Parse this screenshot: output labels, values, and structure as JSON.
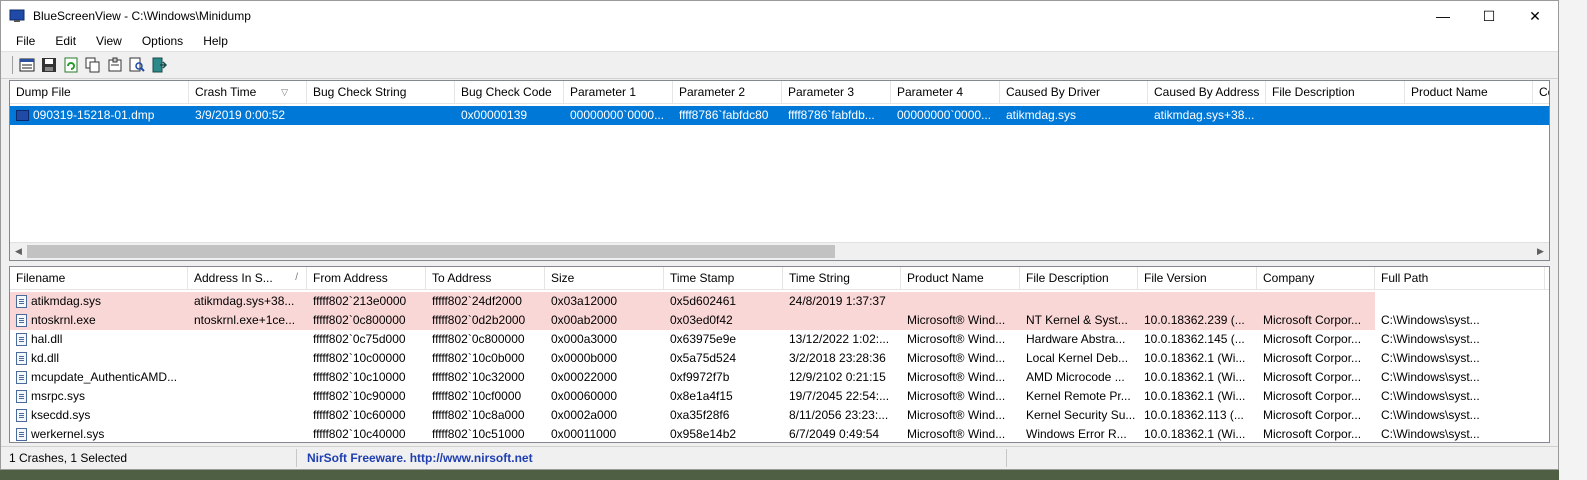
{
  "window": {
    "app_name": "BlueScreenView",
    "title": "BlueScreenView  -  C:\\Windows\\Minidump",
    "minimize_glyph": "—",
    "maximize_glyph": "☐",
    "close_glyph": "✕"
  },
  "menu": [
    "File",
    "Edit",
    "View",
    "Options",
    "Help"
  ],
  "toolbar_icons": [
    "properties-icon",
    "save-icon",
    "refresh-icon",
    "copy-icon",
    "advanced-options-icon",
    "find-icon",
    "exit-icon"
  ],
  "crash_list": {
    "columns": [
      "Dump File",
      "Crash Time",
      "Bug Check String",
      "Bug Check Code",
      "Parameter 1",
      "Parameter 2",
      "Parameter 3",
      "Parameter 4",
      "Caused By Driver",
      "Caused By Address",
      "File Description",
      "Product Name",
      "Com"
    ],
    "sort_indicator": "▽",
    "rows": [
      [
        "090319-15218-01.dmp",
        "3/9/2019 0:00:52",
        "",
        "0x00000139",
        "00000000`0000...",
        "ffff8786`fabfdc80",
        "ffff8786`fabfdb...",
        "00000000`0000...",
        "atikmdag.sys",
        "atikmdag.sys+38...",
        "",
        "",
        ""
      ]
    ]
  },
  "module_list": {
    "columns": [
      "Filename",
      "Address In S...",
      "From Address",
      "To Address",
      "Size",
      "Time Stamp",
      "Time String",
      "Product Name",
      "File Description",
      "File Version",
      "Company",
      "Full Path"
    ],
    "sort_indicator": "/",
    "rows": [
      {
        "highlight": true,
        "cells": [
          "atikmdag.sys",
          "atikmdag.sys+38...",
          "fffff802`213e0000",
          "fffff802`24df2000",
          "0x03a12000",
          "0x5d602461",
          "24/8/2019 1:37:37",
          "",
          "",
          "",
          "",
          ""
        ]
      },
      {
        "highlight": true,
        "cells": [
          "ntoskrnl.exe",
          "ntoskrnl.exe+1ce...",
          "fffff802`0c800000",
          "fffff802`0d2b2000",
          "0x00ab2000",
          "0x03ed0f42",
          "",
          "Microsoft® Wind...",
          "NT Kernel & Syst...",
          "10.0.18362.239 (...",
          "Microsoft Corpor...",
          "C:\\Windows\\syst..."
        ]
      },
      {
        "highlight": false,
        "cells": [
          "hal.dll",
          "",
          "fffff802`0c75d000",
          "fffff802`0c800000",
          "0x000a3000",
          "0x63975e9e",
          "13/12/2022 1:02:...",
          "Microsoft® Wind...",
          "Hardware Abstra...",
          "10.0.18362.145 (...",
          "Microsoft Corpor...",
          "C:\\Windows\\syst..."
        ]
      },
      {
        "highlight": false,
        "cells": [
          "kd.dll",
          "",
          "fffff802`10c00000",
          "fffff802`10c0b000",
          "0x0000b000",
          "0x5a75d524",
          "3/2/2018 23:28:36",
          "Microsoft® Wind...",
          "Local Kernel Deb...",
          "10.0.18362.1 (Wi...",
          "Microsoft Corpor...",
          "C:\\Windows\\syst..."
        ]
      },
      {
        "highlight": false,
        "cells": [
          "mcupdate_AuthenticAMD...",
          "",
          "fffff802`10c10000",
          "fffff802`10c32000",
          "0x00022000",
          "0xf9972f7b",
          "12/9/2102 0:21:15",
          "Microsoft® Wind...",
          "AMD Microcode ...",
          "10.0.18362.1 (Wi...",
          "Microsoft Corpor...",
          "C:\\Windows\\syst..."
        ]
      },
      {
        "highlight": false,
        "cells": [
          "msrpc.sys",
          "",
          "fffff802`10c90000",
          "fffff802`10cf0000",
          "0x00060000",
          "0x8e1a4f15",
          "19/7/2045 22:54:...",
          "Microsoft® Wind...",
          "Kernel Remote Pr...",
          "10.0.18362.1 (Wi...",
          "Microsoft Corpor...",
          "C:\\Windows\\syst..."
        ]
      },
      {
        "highlight": false,
        "cells": [
          "ksecdd.sys",
          "",
          "fffff802`10c60000",
          "fffff802`10c8a000",
          "0x0002a000",
          "0xa35f28f6",
          "8/11/2056 23:23:...",
          "Microsoft® Wind...",
          "Kernel Security Su...",
          "10.0.18362.113 (...",
          "Microsoft Corpor...",
          "C:\\Windows\\syst..."
        ]
      },
      {
        "highlight": false,
        "cells": [
          "werkernel.sys",
          "",
          "fffff802`10c40000",
          "fffff802`10c51000",
          "0x00011000",
          "0x958e14b2",
          "6/7/2049 0:49:54",
          "Microsoft® Wind...",
          "Windows Error R...",
          "10.0.18362.1 (Wi...",
          "Microsoft Corpor...",
          "C:\\Windows\\syst..."
        ]
      }
    ]
  },
  "status": {
    "count": "1 Crashes, 1 Selected",
    "link": "NirSoft Freeware.  http://www.nirsoft.net"
  },
  "colors": {
    "selection": "#0078d7",
    "highlight_row": "#fad7d7",
    "link": "#1f3fb0"
  }
}
